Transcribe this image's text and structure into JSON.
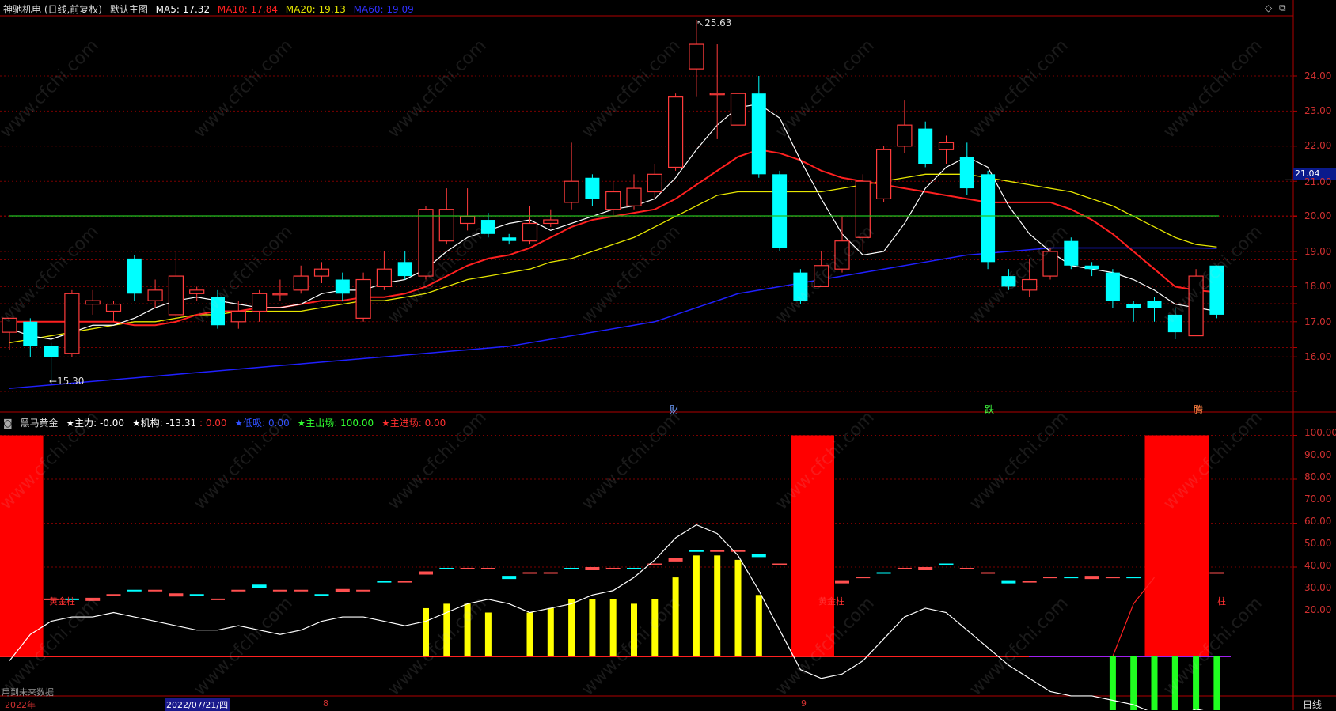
{
  "main_header": {
    "stock": "神驰机电 (日线,前复权)",
    "template": "默认主图",
    "ma5": "MA5: 17.32",
    "ma10": "MA10: 17.84",
    "ma20": "MA20: 19.13",
    "ma60": "MA60: 19.09"
  },
  "indicator_header": {
    "name": "黑马黄金",
    "zhuli": "★主力: -0.00",
    "jigou": "★机构: -13.31",
    "jigou_extra": ": 0.00",
    "dixi": "★低吸: 0.00",
    "zhuchu": "★主出场: 100.00",
    "zhujin": "★主进场: 0.00"
  },
  "colors": {
    "up": "#ff3b3b",
    "down": "#00ffff",
    "ma5": "#ffffff",
    "ma10": "#ff2020",
    "ma20": "#e6e600",
    "ma60": "#2020ff",
    "grid": "#7a0000"
  },
  "price_axis": [
    "24.00",
    "23.00",
    "22.00",
    "21.00",
    "20.00",
    "19.00",
    "18.00",
    "17.00",
    "16.00"
  ],
  "last_price": "21.04",
  "high_label": "25.63",
  "low_label": "15.30",
  "indicator_axis": [
    "100.00",
    "90.00",
    "80.00",
    "70.00",
    "60.00",
    "50.00",
    "40.00",
    "30.00",
    "20.00"
  ],
  "x_labels": [
    "2022年",
    "2022/07/21/四",
    "8",
    "9"
  ],
  "period": "日线",
  "future_note": "用到未来数据",
  "signals": [
    {
      "text": "财",
      "color": "#6fa0ff"
    },
    {
      "text": "跌",
      "color": "#40ff40"
    },
    {
      "text": "腾",
      "color": "#ff8040"
    }
  ],
  "annotations": [
    "黄金柱",
    "黄金柱",
    "柱"
  ],
  "watermark": "www.cfchi.com",
  "icons": [
    "diamond-icon",
    "restore-window-icon",
    "collapse-icon"
  ],
  "chart_data": {
    "type": "candlestick",
    "candles": [
      [
        16.7,
        17.1,
        16.2,
        17.0
      ],
      [
        17.0,
        16.3,
        16.0,
        17.1
      ],
      [
        16.3,
        16.0,
        15.3,
        16.4
      ],
      [
        16.1,
        17.8,
        16.0,
        17.9
      ],
      [
        17.5,
        17.6,
        17.2,
        17.9
      ],
      [
        17.3,
        17.5,
        17.0,
        17.6
      ],
      [
        18.8,
        17.8,
        17.6,
        18.9
      ],
      [
        17.6,
        17.9,
        17.4,
        18.2
      ],
      [
        17.2,
        18.3,
        17.0,
        19.0
      ],
      [
        17.8,
        17.9,
        17.6,
        18.0
      ],
      [
        17.7,
        16.9,
        16.8,
        17.9
      ],
      [
        17.0,
        17.3,
        16.8,
        17.6
      ],
      [
        17.3,
        17.8,
        17.0,
        17.9
      ],
      [
        17.8,
        17.8,
        17.6,
        18.2
      ],
      [
        17.9,
        18.3,
        17.8,
        18.6
      ],
      [
        18.3,
        18.5,
        18.1,
        18.7
      ],
      [
        18.2,
        17.8,
        17.6,
        18.4
      ],
      [
        17.1,
        18.2,
        17.0,
        18.4
      ],
      [
        18.0,
        18.5,
        17.9,
        19.0
      ],
      [
        18.7,
        18.3,
        18.2,
        19.0
      ],
      [
        18.3,
        20.2,
        18.2,
        20.3
      ],
      [
        19.3,
        20.2,
        19.2,
        20.8
      ],
      [
        19.8,
        20.0,
        19.6,
        20.8
      ],
      [
        19.9,
        19.5,
        19.4,
        20.1
      ],
      [
        19.4,
        19.3,
        19.2,
        19.5
      ],
      [
        19.3,
        19.8,
        19.2,
        20.3
      ],
      [
        19.8,
        19.9,
        19.7,
        20.2
      ],
      [
        20.4,
        21.0,
        20.2,
        22.1
      ],
      [
        21.1,
        20.5,
        20.3,
        21.2
      ],
      [
        20.2,
        20.7,
        20.0,
        21.0
      ],
      [
        20.3,
        20.8,
        20.2,
        21.2
      ],
      [
        20.7,
        21.2,
        20.5,
        21.5
      ],
      [
        21.4,
        23.4,
        21.3,
        23.5
      ],
      [
        24.2,
        24.9,
        23.4,
        25.6
      ],
      [
        23.5,
        23.5,
        22.2,
        24.9
      ],
      [
        22.6,
        23.5,
        22.5,
        24.2
      ],
      [
        23.5,
        21.2,
        21.1,
        24.0
      ],
      [
        21.2,
        19.1,
        19.0,
        21.3
      ],
      [
        18.4,
        17.6,
        17.5,
        18.5
      ],
      [
        18.0,
        18.6,
        18.0,
        19.0
      ],
      [
        18.5,
        19.3,
        18.4,
        20.0
      ],
      [
        19.4,
        21.0,
        19.0,
        21.2
      ],
      [
        20.5,
        21.9,
        20.4,
        22.0
      ],
      [
        22.0,
        22.6,
        21.8,
        23.3
      ],
      [
        22.5,
        21.5,
        21.4,
        22.7
      ],
      [
        21.9,
        22.1,
        21.5,
        22.3
      ],
      [
        21.7,
        20.8,
        20.6,
        22.1
      ],
      [
        21.2,
        18.7,
        18.5,
        21.3
      ],
      [
        18.3,
        18.0,
        17.9,
        18.5
      ],
      [
        17.9,
        18.2,
        17.7,
        18.8
      ],
      [
        18.3,
        19.0,
        18.2,
        19.1
      ],
      [
        19.3,
        18.6,
        18.5,
        19.4
      ],
      [
        18.6,
        18.5,
        18.3,
        18.7
      ],
      [
        18.4,
        17.6,
        17.4,
        18.5
      ],
      [
        17.5,
        17.4,
        17.0,
        17.6
      ],
      [
        17.6,
        17.4,
        17.0,
        17.7
      ],
      [
        17.2,
        16.7,
        16.5,
        17.4
      ],
      [
        16.6,
        18.3,
        16.6,
        18.5
      ],
      [
        18.6,
        17.2,
        17.1,
        18.6
      ]
    ],
    "ma5": [
      16.8,
      16.6,
      16.5,
      16.7,
      16.9,
      16.9,
      17.1,
      17.4,
      17.6,
      17.7,
      17.6,
      17.5,
      17.4,
      17.4,
      17.5,
      17.8,
      17.9,
      17.9,
      18.1,
      18.2,
      18.5,
      19.0,
      19.4,
      19.6,
      19.8,
      19.9,
      19.6,
      19.8,
      20.0,
      20.2,
      20.3,
      20.5,
      21.1,
      21.9,
      22.6,
      23.1,
      23.2,
      22.8,
      21.6,
      20.5,
      19.5,
      18.9,
      19.0,
      19.8,
      20.8,
      21.4,
      21.7,
      21.4,
      20.3,
      19.5,
      19.0,
      18.6,
      18.5,
      18.4,
      18.2,
      17.9,
      17.5,
      17.4,
      17.3
    ],
    "ma10": [
      17.0,
      17.0,
      17.0,
      17.0,
      17.0,
      17.0,
      16.9,
      16.9,
      17.0,
      17.2,
      17.3,
      17.3,
      17.4,
      17.4,
      17.5,
      17.6,
      17.6,
      17.7,
      17.7,
      17.8,
      18.0,
      18.3,
      18.6,
      18.8,
      18.9,
      19.1,
      19.4,
      19.7,
      19.9,
      20.0,
      20.1,
      20.2,
      20.5,
      20.9,
      21.3,
      21.7,
      21.9,
      21.8,
      21.6,
      21.3,
      21.1,
      21.0,
      20.9,
      20.8,
      20.7,
      20.6,
      20.5,
      20.4,
      20.4,
      20.4,
      20.4,
      20.2,
      19.9,
      19.5,
      19.0,
      18.5,
      18.0,
      17.9,
      17.84
    ],
    "ma20": [
      16.4,
      16.5,
      16.6,
      16.7,
      16.8,
      16.9,
      17.0,
      17.0,
      17.1,
      17.2,
      17.2,
      17.3,
      17.3,
      17.3,
      17.3,
      17.4,
      17.5,
      17.6,
      17.6,
      17.7,
      17.8,
      18.0,
      18.2,
      18.3,
      18.4,
      18.5,
      18.7,
      18.8,
      19.0,
      19.2,
      19.4,
      19.7,
      20.0,
      20.3,
      20.6,
      20.7,
      20.7,
      20.7,
      20.7,
      20.7,
      20.8,
      20.9,
      21.0,
      21.1,
      21.2,
      21.2,
      21.2,
      21.1,
      21.0,
      20.9,
      20.8,
      20.7,
      20.5,
      20.3,
      20.0,
      19.7,
      19.4,
      19.2,
      19.13
    ],
    "ma60": [
      15.1,
      15.15,
      15.2,
      15.25,
      15.3,
      15.35,
      15.4,
      15.45,
      15.5,
      15.55,
      15.6,
      15.65,
      15.7,
      15.75,
      15.8,
      15.85,
      15.9,
      15.95,
      16.0,
      16.05,
      16.1,
      16.15,
      16.2,
      16.25,
      16.3,
      16.4,
      16.5,
      16.6,
      16.7,
      16.8,
      16.9,
      17.0,
      17.2,
      17.4,
      17.6,
      17.8,
      17.9,
      18.0,
      18.1,
      18.2,
      18.3,
      18.4,
      18.5,
      18.6,
      18.7,
      18.8,
      18.9,
      18.95,
      19.0,
      19.05,
      19.1,
      19.1,
      19.1,
      19.1,
      19.1,
      19.1,
      19.1,
      19.1,
      19.09
    ],
    "ind_white": [
      -1,
      5,
      8,
      9,
      9,
      10,
      9,
      8,
      7,
      6,
      6,
      7,
      6,
      5,
      6,
      8,
      9,
      9,
      8,
      7,
      8,
      10,
      12,
      13,
      12,
      10,
      11,
      12,
      14,
      15,
      18,
      22,
      27,
      30,
      28,
      23,
      15,
      6,
      -3,
      -5,
      -4,
      -1,
      4,
      9,
      11,
      10,
      6,
      2,
      -2,
      -5,
      -8,
      -9,
      -9,
      -10,
      -11,
      -13,
      -14,
      -12,
      -13
    ],
    "ind_yellow": [
      0,
      0,
      0,
      0,
      0,
      0,
      0,
      0,
      0,
      0,
      0,
      0,
      0,
      0,
      0,
      0,
      0,
      0,
      0,
      0,
      11,
      12,
      12,
      10,
      0,
      10,
      11,
      13,
      13,
      13,
      12,
      13,
      18,
      23,
      23,
      22,
      14,
      0,
      0,
      0,
      0,
      0,
      0,
      0,
      0,
      0,
      0,
      0,
      0,
      0,
      0,
      0,
      0,
      0,
      0,
      0,
      0,
      0,
      0
    ],
    "ind_green": [
      0,
      0,
      0,
      0,
      0,
      0,
      0,
      0,
      0,
      0,
      0,
      0,
      0,
      0,
      0,
      0,
      0,
      0,
      0,
      0,
      0,
      0,
      0,
      0,
      0,
      0,
      0,
      0,
      0,
      0,
      0,
      0,
      0,
      0,
      0,
      0,
      0,
      0,
      0,
      0,
      0,
      0,
      0,
      0,
      0,
      0,
      0,
      0,
      0,
      0,
      0,
      0,
      0,
      -13,
      -15,
      -15,
      -17,
      -14,
      -13
    ],
    "ind_red_bars": [
      [
        0,
        2
      ],
      [
        38,
        40
      ],
      [
        55,
        58
      ]
    ],
    "ind_dash": [
      9,
      12,
      13,
      13,
      13,
      14,
      15,
      15,
      14,
      14,
      13,
      15,
      16,
      15,
      15,
      14,
      15,
      15,
      17,
      17,
      19,
      20,
      20,
      20,
      18,
      19,
      19,
      20,
      20,
      20,
      20,
      21,
      22,
      24,
      24,
      24,
      23,
      21,
      18,
      17,
      17,
      18,
      19,
      20,
      20,
      21,
      20,
      19,
      17,
      17,
      18,
      18,
      18,
      18,
      18,
      17,
      17,
      18,
      19
    ]
  }
}
